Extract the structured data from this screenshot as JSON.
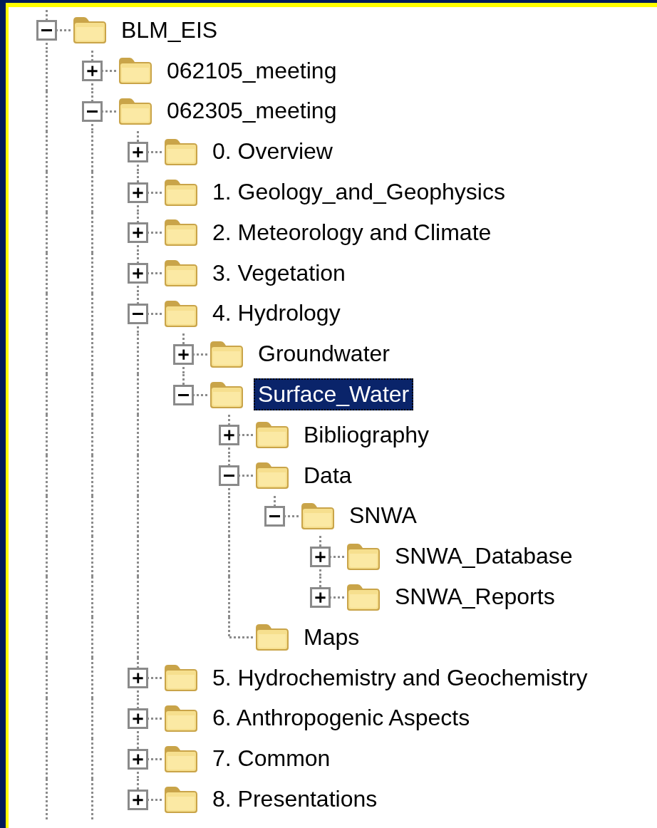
{
  "tree": [
    {
      "label": "BLM_EIS",
      "expanded": true,
      "selected": false,
      "children": [
        {
          "label": "062105_meeting",
          "expanded": false,
          "selected": false
        },
        {
          "label": "062305_meeting",
          "expanded": true,
          "selected": false,
          "children": [
            {
              "label": "0. Overview",
              "expanded": false,
              "selected": false
            },
            {
              "label": "1. Geology_and_Geophysics",
              "expanded": false,
              "selected": false
            },
            {
              "label": "2. Meteorology and Climate",
              "expanded": false,
              "selected": false
            },
            {
              "label": "3. Vegetation",
              "expanded": false,
              "selected": false
            },
            {
              "label": "4. Hydrology",
              "expanded": true,
              "selected": false,
              "children": [
                {
                  "label": "Groundwater",
                  "expanded": false,
                  "selected": false
                },
                {
                  "label": "Surface_Water",
                  "expanded": true,
                  "selected": true,
                  "children": [
                    {
                      "label": "Bibliography",
                      "expanded": false,
                      "selected": false
                    },
                    {
                      "label": "Data",
                      "expanded": true,
                      "selected": false,
                      "children": [
                        {
                          "label": "SNWA",
                          "expanded": true,
                          "selected": false,
                          "children": [
                            {
                              "label": "SNWA_Database",
                              "expanded": false,
                              "selected": false
                            },
                            {
                              "label": "SNWA_Reports",
                              "expanded": false,
                              "selected": false
                            }
                          ]
                        }
                      ]
                    },
                    {
                      "label": "Maps",
                      "selected": false
                    }
                  ]
                }
              ]
            },
            {
              "label": "5. Hydrochemistry and Geochemistry",
              "expanded": false,
              "selected": false
            },
            {
              "label": "6. Anthropogenic Aspects",
              "expanded": false,
              "selected": false
            },
            {
              "label": "7. Common",
              "expanded": false,
              "selected": false
            },
            {
              "label": "8. Presentations",
              "expanded": false,
              "selected": false
            }
          ]
        }
      ]
    }
  ]
}
